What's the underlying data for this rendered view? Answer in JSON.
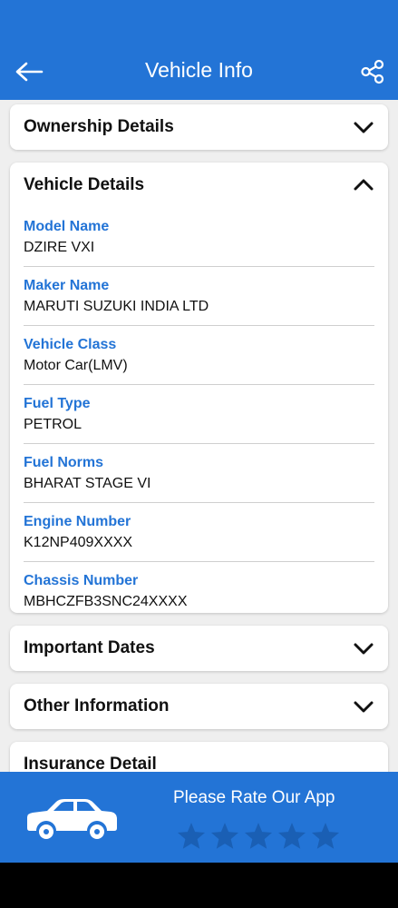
{
  "header": {
    "title": "Vehicle Info",
    "back_icon": "arrow-left-icon",
    "share_icon": "share-icon",
    "color": "#2374d6"
  },
  "sections": {
    "ownership": {
      "title": "Ownership Details",
      "state": "collapsed"
    },
    "vehicle": {
      "title": "Vehicle Details",
      "state": "expanded",
      "fields": [
        {
          "label": "Model Name",
          "value": "DZIRE VXI"
        },
        {
          "label": "Maker Name",
          "value": "MARUTI SUZUKI INDIA LTD"
        },
        {
          "label": "Vehicle Class",
          "value": "Motor Car(LMV)"
        },
        {
          "label": "Fuel Type",
          "value": "PETROL"
        },
        {
          "label": "Fuel Norms",
          "value": "BHARAT STAGE VI"
        },
        {
          "label": "Engine Number",
          "value": "K12NP409XXXX"
        },
        {
          "label": "Chassis Number",
          "value": "MBHCZFB3SNC24XXXX"
        }
      ]
    },
    "important_dates": {
      "title": "Important Dates",
      "state": "collapsed"
    },
    "other_info": {
      "title": "Other Information",
      "state": "collapsed"
    },
    "insurance": {
      "title": "Insurance Detail",
      "state": "collapsed"
    }
  },
  "footer": {
    "rate_text": "Please Rate Our App",
    "star_count": 5,
    "star_color": "#1a5fb4",
    "icon": "car-icon"
  }
}
